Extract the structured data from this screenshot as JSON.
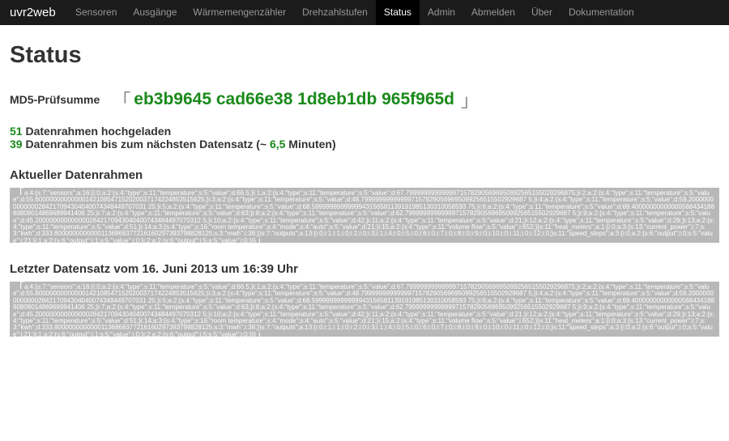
{
  "navbar": {
    "brand": "uvr2web",
    "items": [
      {
        "label": "Sensoren",
        "active": false
      },
      {
        "label": "Ausgänge",
        "active": false
      },
      {
        "label": "Wärmemengenzähler",
        "active": false
      },
      {
        "label": "Drehzahlstufen",
        "active": false
      },
      {
        "label": "Status",
        "active": true
      },
      {
        "label": "Admin",
        "active": false
      },
      {
        "label": "Abmelden",
        "active": false
      },
      {
        "label": "Über",
        "active": false
      },
      {
        "label": "Dokumentation",
        "active": false
      }
    ]
  },
  "page": {
    "title": "Status",
    "md5_label": "MD5-Prüfsumme",
    "md5_open": "「",
    "md5_hash": "eb3b9645 cad66e38 1d8eb1db 965f965d",
    "md5_close": "」",
    "uploaded_count": "51",
    "uploaded_text": " Datenrahmen hochgeladen",
    "remaining_count": "39",
    "remaining_text_1": " Datenrahmen bis zum nächsten Datensatz (~ ",
    "remaining_minutes": "6,5",
    "remaining_text_2": " Minuten)",
    "current_frame_heading": "Aktueller Datenrahmen",
    "current_frame_data": "a:4:{s:7:\"sensors\";a:16:{i:0;a:2:{s:4:\"type\";s:11:\"temperature\";s:5:\"value\";d:66.5;}i:1;a:2:{s:4:\"type\";s:11:\"temperature\";s:5:\"value\";d:67.79999999999999715782905696950992565155029296875;}i:2;a:2:{s:4:\"type\";s:11:\"temperature\";s:5:\"value\";d:55.60000000000000142108547152020037174224853515625;}i:3;a:2:{s:4:\"type\";s:11:\"temperature\";s:5:\"value\";d:48.7999999999999971578290569695099256515502929687 5;}i:4;a:2:{s:4:\"type\";s:11:\"temperature\";s:5:\"value\";d:59.20000000000000284217094304040074348449707031 25;}i:5;a:2:{s:4:\"type\";s:11:\"temperature\";s:5:\"value\";d:68.5999999999999943156581139191985130310058593 75;}i:6;a:2:{s:4:\"type\";s:11:\"temperature\";s:5:\"value\";d:69.4000000000000056843418860808014869689941406 25;}i:7;a:2:{s:4:\"type\";s:11:\"temperature\";s:5:\"value\";d:63;}i:8;a:2:{s:4:\"type\";s:11:\"temperature\";s:5:\"value\";d:62.7999999999999971578290569695099256515502929687 5;}i:9;a:2:{s:4:\"type\";s:11:\"temperature\";s:5:\"value\";d:45.2000000000000002842170943040400743484497070312 5;}i:10;a:2:{s:4:\"type\";s:11:\"temperature\";s:5:\"value\";d:42;}i:11;a:2:{s:4:\"type\";s:11:\"temperature\";s:5:\"value\";d:21;}i:12;a:2:{s:4:\"type\";s:11:\"temperature\";s:5:\"value\";d:29;}i:13;a:2:{s:4:\"type\";s:11:\"temperature\";s:5:\"value\";d:51;}i:14;a:3:{s:4:\"type\";s:16:\"room temperature\";s:4:\"mode\";s:4:\"auto\";s:5:\"value\";d:21;}i:15;a:2:{s:4:\"type\";s:11:\"volume flow\";s:5:\"value\";i:652;}}s:11:\"heat_meters\";a:1:{i:0;a:3:{s:13:\"current_power\";i:7;s:3:\"kwh\";d:333.80000000000001136868377216160297393798828125;s:3:\"mwh\";i:38;}}s:7:\"outputs\";a:13:{i:0;i:1;i:1;i:0;i:2;i:0;i:3;i:1;i:4;i:0;i:5;i:0;i:6;i:0;i:7;i:0;i:8;i:0;i:9;i:0;i:10;i:0;i:11;i:0;i:12;i:0;}s:11:\"speed_steps\";a:3:{i:0;a:2:{s:6:\"output\";i:0;s:5:\"value\";i:21;}i:1;a:2:{s:6:\"output\";i:1;s:5:\"value\";i:0;}i:2;a:2:{s:6:\"output\";i:5;s:5:\"value\";i:0;}}}",
    "last_record_heading": "Letzter Datensatz vom 16. Juni 2013 um 16:39 Uhr",
    "last_record_data": "a:4:{s:7:\"sensors\";a:16:{i:0;a:2:{s:4:\"type\";s:11:\"temperature\";s:5:\"value\";d:66.5;}i:1;a:2:{s:4:\"type\";s:11:\"temperature\";s:5:\"value\";d:67.79999999999999715782905696950992565155029296875;}i:2;a:2:{s:4:\"type\";s:11:\"temperature\";s:5:\"value\";d:55.60000000000000142108547152020037174224853515625;}i:3;a:2:{s:4:\"type\";s:11:\"temperature\";s:5:\"value\";d:48.7999999999999971578290569695099256515502929687 5;}i:4;a:2:{s:4:\"type\";s:11:\"temperature\";s:5:\"value\";d:59.20000000000000284217094304040074348449707031 25;}i:5;a:2:{s:4:\"type\";s:11:\"temperature\";s:5:\"value\";d:68.5999999999999943156581139191985130310058593 75;}i:6;a:2:{s:4:\"type\";s:11:\"temperature\";s:5:\"value\";d:69.4000000000000056843418860808014869689941406 25;}i:7;a:2:{s:4:\"type\";s:11:\"temperature\";s:5:\"value\";d:63;}i:8;a:2:{s:4:\"type\";s:11:\"temperature\";s:5:\"value\";d:62.7999999999999971578290569695099256515502929687 5;}i:9;a:2:{s:4:\"type\";s:11:\"temperature\";s:5:\"value\";d:45.2000000000000002842170943040400743484497070312 5;}i:10;a:2:{s:4:\"type\";s:11:\"temperature\";s:5:\"value\";d:42;}i:11;a:2:{s:4:\"type\";s:11:\"temperature\";s:5:\"value\";d:21;}i:12;a:2:{s:4:\"type\";s:11:\"temperature\";s:5:\"value\";d:29;}i:13;a:2:{s:4:\"type\";s:11:\"temperature\";s:5:\"value\";d:51;}i:14;a:3:{s:4:\"type\";s:16:\"room temperature\";s:4:\"mode\";s:4:\"auto\";s:5:\"value\";d:21;}i:15;a:2:{s:4:\"type\";s:11:\"volume flow\";s:5:\"value\";i:652;}}s:11:\"heat_meters\";a:1:{i:0;a:3:{s:13:\"current_power\";i:7;s:3:\"kwh\";d:333.80000000000001136868377216160297393798828125;s:3:\"mwh\";i:38;}}s:7:\"outputs\";a:13:{i:0;i:1;i:1;i:0;i:2;i:0;i:3;i:1;i:4;i:0;i:5;i:0;i:6;i:0;i:7;i:0;i:8;i:0;i:9;i:0;i:10;i:0;i:11;i:0;i:12;i:0;}s:11:\"speed_steps\";a:3:{i:0;a:2:{s:6:\"output\";i:0;s:5:\"value\";i:21;}i:1;a:2:{s:6:\"output\";i:1;s:5:\"value\";i:0;}i:2;a:2:{s:6:\"output\";i:5;s:5:\"value\";i:0;}}}",
    "data_open": "「",
    "data_close": "」"
  }
}
